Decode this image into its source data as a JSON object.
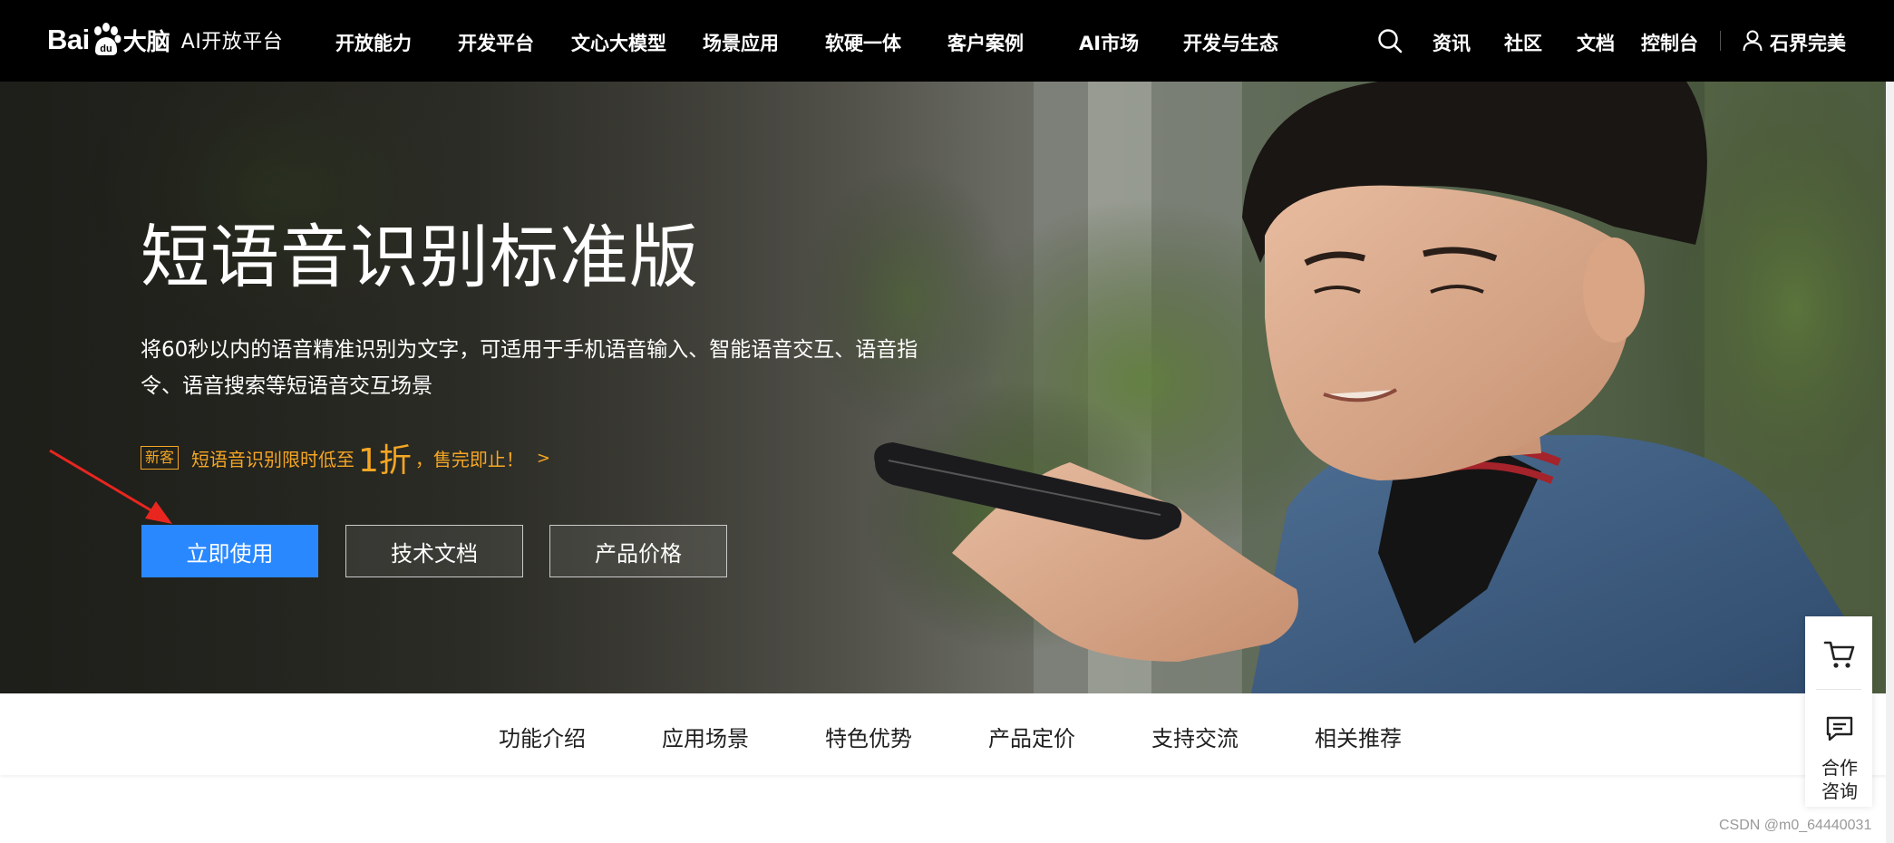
{
  "brand": {
    "logo_bai": "Bai",
    "logo_dana": "大脑",
    "platform": "AI开放平台"
  },
  "nav": {
    "items": [
      "开放能力",
      "开发平台",
      "文心大模型",
      "场景应用",
      "软硬一体",
      "客户案例",
      "AI市场",
      "开发与生态"
    ],
    "right_items": [
      "资讯",
      "社区",
      "文档",
      "控制台"
    ],
    "user_name": "石界完美"
  },
  "hero": {
    "title": "短语音识别标准版",
    "description": "将60秒以内的语音精准识别为文字，可适用于手机语音输入、智能语音交互、语音指令、语音搜索等短语音交互场景",
    "promo": {
      "badge": "新客",
      "text_before": "短语音识别限时低至",
      "highlight": "1折",
      "text_after": "，售完即止！",
      "arrow": ">"
    },
    "buttons": {
      "primary": "立即使用",
      "docs": "技术文档",
      "pricing": "产品价格"
    }
  },
  "subnav": {
    "items": [
      "功能介绍",
      "应用场景",
      "特色优势",
      "产品定价",
      "支持交流",
      "相关推荐"
    ]
  },
  "sidepanel": {
    "consult_label": "合作咨询"
  },
  "watermark": "CSDN @m0_64440031",
  "colors": {
    "nav_bg": "#000000",
    "primary": "#2a88ff",
    "promo": "#f5a623",
    "annotation_arrow": "#e8261f"
  }
}
